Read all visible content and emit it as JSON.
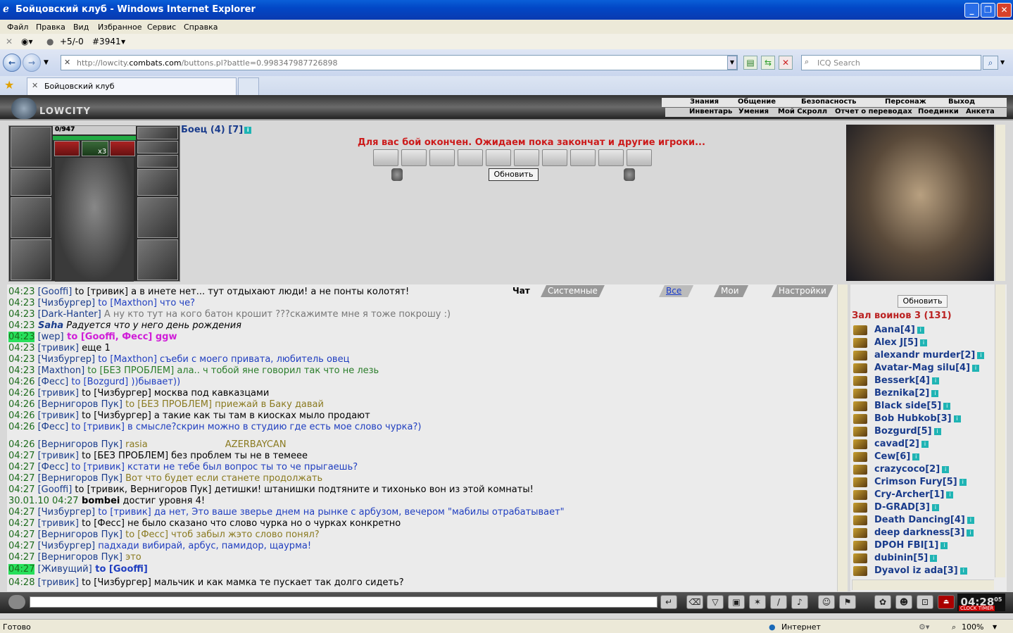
{
  "window": {
    "title": "Бойцовский клуб - Windows Internet Explorer"
  },
  "menu": [
    "Файл",
    "Правка",
    "Вид",
    "Избранное",
    "Сервис",
    "Справка"
  ],
  "toolbar2": {
    "rating": "+5/-0",
    "num": "#3941"
  },
  "address": {
    "prefix": "http://lowcity.",
    "host": "combats.com",
    "suffix": "/buttons.pl?battle=0.998347987726898",
    "search_placeholder": "ICQ Search"
  },
  "tab": {
    "title": "Бойцовский клуб"
  },
  "game": {
    "logo": "LOWCITY",
    "top_menu": [
      "Знания",
      "Общение",
      "Безопасность",
      "Персонаж",
      "Выход"
    ],
    "sub_menu": [
      "Инвентарь",
      "Умения",
      "Мой Скролл",
      "Отчет о переводах",
      "Поединки",
      "Анкета"
    ],
    "hp": "0/947",
    "multiplier": "x3",
    "fighter": "Боец (4) [7]",
    "battle_message": "Для вас бой окончен. Ожидаем пока закончат и другие игроки...",
    "refresh_button": "Обновить"
  },
  "chat": {
    "tabs": [
      "Чат",
      "Системные сообщения",
      "Все логи",
      "Мои логи",
      "Настройки"
    ],
    "lines": [
      {
        "t": "04:23",
        "n": "[Gooffi]",
        "m": " to [тривик] а в инете нет... тут отдыхают люди! а не понты колотят!",
        "c": ""
      },
      {
        "t": "04:23",
        "n": "[Чизбургер]",
        "m": " to [Maxthon] что че?",
        "c": "blue"
      },
      {
        "t": "04:23",
        "n": "[Dark-Hanter]",
        "m": " А ну кто тут на кого батон крошит ???скажимте мне я тоже покрошу :)",
        "c": "gray"
      },
      {
        "t": "04:23",
        "n": "Saha",
        "m": " Радуется что у него день рождения",
        "c": "italic"
      },
      {
        "t": "04:23",
        "n": "[wep]",
        "m": " to [Gooffi, Фесс] ggw",
        "c": "magenta",
        "h": true
      },
      {
        "t": "04:23",
        "n": "[тривик]",
        "m": " еще 1",
        "c": ""
      },
      {
        "t": "04:23",
        "n": "[Чизбургер]",
        "m": " to [Maxthon] съеби с моего привата, любитель овец",
        "c": "blue"
      },
      {
        "t": "04:23",
        "n": "[Maxthon]",
        "m": " to [БЕЗ ПРОБЛЕМ] ала.. ч тобой яне говорил так что не лезь",
        "c": "green"
      },
      {
        "t": "04:26",
        "n": "[Фесс]",
        "m": " to [Bozgurd] ))бывает))",
        "c": "blue"
      },
      {
        "t": "04:26",
        "n": "[тривик]",
        "m": " to [Чизбургер] москва под кавказцами",
        "c": ""
      },
      {
        "t": "04:26",
        "n": "[Вернигоров Пук]",
        "m": " to [БЕЗ ПРОБЛЕМ] приежай в Баку давай",
        "c": "olive"
      },
      {
        "t": "04:26",
        "n": "[тривик]",
        "m": " to [Чизбургер] а такие как ты там в киосках мыло продают",
        "c": ""
      },
      {
        "t": "04:26",
        "n": "[Фесс]",
        "m": " to [тривик] в смысле?скрин можно в студию где есть мое слово чурка?)",
        "c": "blue"
      },
      {
        "t": "04:26",
        "n": "[Вернигоров Пук]",
        "m": " rasia",
        "c": "olive",
        "extra": "AZERBAYCAN"
      },
      {
        "t": "04:27",
        "n": "[тривик]",
        "m": " to [БЕЗ ПРОБЛЕМ] без проблем ты не в темеее",
        "c": ""
      },
      {
        "t": "04:27",
        "n": "[Фесс]",
        "m": " to [тривик] кстати не тебе был вопрос ты то че прыгаешь?",
        "c": "blue"
      },
      {
        "t": "04:27",
        "n": "[Вернигоров Пук]",
        "m": " Вот что будет если станете продолжать",
        "c": "olive"
      },
      {
        "t": "04:27",
        "n": "[Gooffi]",
        "m": " to [тривик, Вернигоров Пук] детишки! штанишки подтяните и тихонько вон из этой комнаты!",
        "c": ""
      },
      {
        "t": "30.01.10 04:27",
        "n": "bombei",
        "m": " достиг уровня 4!",
        "c": "sys"
      },
      {
        "t": "04:27",
        "n": "[Чизбургер]",
        "m": " to [тривик] да нет, Это ваше зверье днем на рынке с арбузом, вечером \"мабилы отрабатывает\"",
        "c": "blue"
      },
      {
        "t": "04:27",
        "n": "[тривик]",
        "m": " to [Фесс] не было сказано что слово чурка но о чурках конкретно",
        "c": ""
      },
      {
        "t": "04:27",
        "n": "[Вернигоров Пук]",
        "m": " to [Фесс] чтоб забыл жэто слово понял?",
        "c": "olive"
      },
      {
        "t": "04:27",
        "n": "[Чизбургер]",
        "m": " падхади вибирай, арбус, памидор, щаурма!",
        "c": "blue"
      },
      {
        "t": "04:27",
        "n": "[Вернигоров Пук]",
        "m": " это",
        "c": "olive"
      },
      {
        "t": "04:27",
        "n": "[Живущий]",
        "m": " to [Gooffi]",
        "c": "bluebold",
        "h": true
      },
      {
        "t": "04:28",
        "n": "[тривик]",
        "m": " to [Чизбургер] мальчик и как мамка те пускает так долго сидеть?",
        "c": ""
      }
    ]
  },
  "users": {
    "refresh": "Обновить",
    "hall": "Зал воинов 3 (131)",
    "list": [
      "Aana[4]",
      "Alex J[5]",
      "alexandr murder[2]",
      "Avatar-Mag silu[4]",
      "Besserk[4]",
      "Beznika[2]",
      "Black side[5]",
      "Bob Hubkob[3]",
      "Bozgurd[5]",
      "cavad[2]",
      "Cew[6]",
      "crazycoco[2]",
      "Crimson Fury[5]",
      "Cry-Archer[1]",
      "D-GRAD[3]",
      "Death Dancing[4]",
      "deep darkness[3]",
      "DPOH FBI[1]",
      "dubinin[5]",
      "Dyavol iz ada[3]"
    ]
  },
  "clock": {
    "time": "04:28",
    "sec": "05",
    "label": "CLOCK TIMER"
  },
  "status": {
    "left": "Готово",
    "zone": "Интернет",
    "zoom": "100%"
  }
}
